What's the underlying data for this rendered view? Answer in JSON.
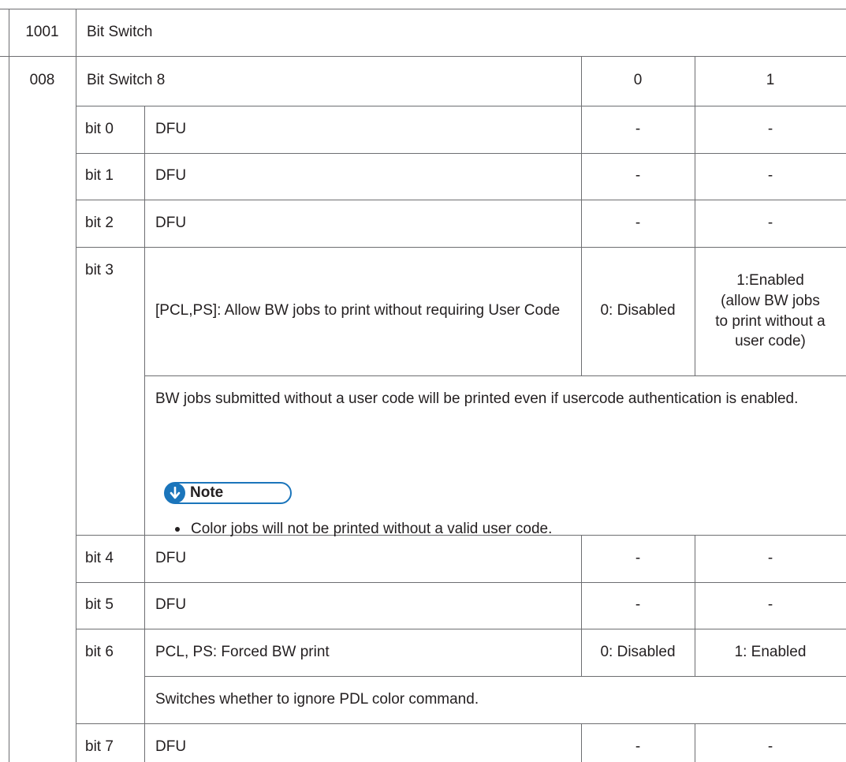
{
  "header": {
    "code": "1001",
    "title": "Bit Switch"
  },
  "switch": {
    "code": "008",
    "title": "Bit Switch 8",
    "col0": "0",
    "col1": "1"
  },
  "rows": [
    {
      "bit": "bit 0",
      "desc": "DFU",
      "v0": "-",
      "v1": "-"
    },
    {
      "bit": "bit 1",
      "desc": "DFU",
      "v0": "-",
      "v1": "-"
    },
    {
      "bit": "bit 2",
      "desc": "DFU",
      "v0": "-",
      "v1": "-"
    },
    {
      "bit": "bit 3",
      "desc": "[PCL,PS]: Allow BW jobs to print without requiring User Code",
      "v0": "0: Disabled",
      "v1_lines": [
        "1:Enabled",
        "(allow BW jobs",
        "to print without a",
        "user code)"
      ]
    },
    {
      "bit": "bit 4",
      "desc": "DFU",
      "v0": "-",
      "v1": "-"
    },
    {
      "bit": "bit 5",
      "desc": "DFU",
      "v0": "-",
      "v1": "-"
    },
    {
      "bit": "bit 6",
      "desc": "PCL, PS: Forced BW print",
      "v0": "0: Disabled",
      "v1": "1: Enabled"
    },
    {
      "bit": "bit 7",
      "desc": "DFU",
      "v0": "-",
      "v1": "-"
    }
  ],
  "bit3_detail": {
    "text": "BW jobs submitted without a user code will be printed even if usercode authentication is enabled.",
    "note_label": "Note",
    "note_icon": "down-arrow-circle-icon",
    "bullet": "Color jobs will not be printed without a valid user code."
  },
  "bit6_detail": {
    "text": "Switches whether to ignore PDL color command."
  },
  "colors": {
    "line": "#6d6e71",
    "note_accent": "#1b75bb",
    "text": "#231f20"
  }
}
